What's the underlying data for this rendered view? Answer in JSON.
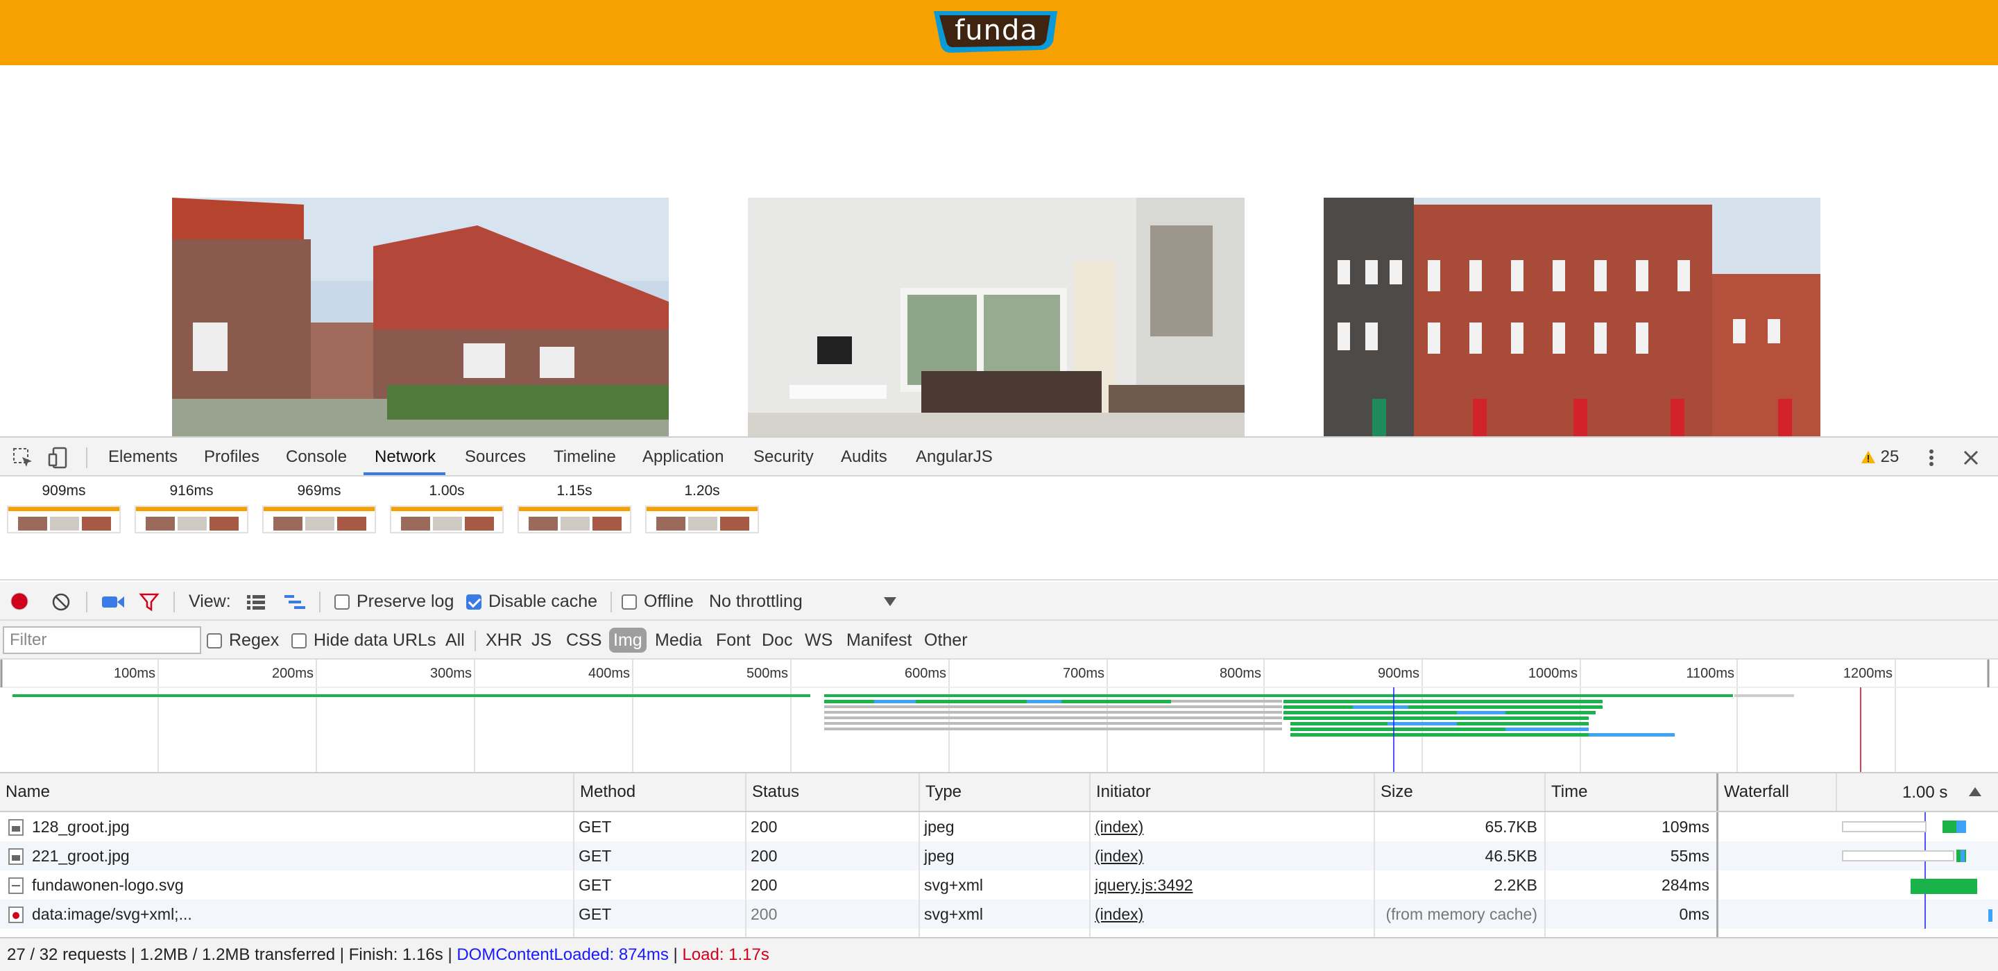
{
  "site": {
    "logo_text": "funda",
    "header_color": "#f7a100"
  },
  "devtools": {
    "tabs": [
      "Elements",
      "Profiles",
      "Console",
      "Network",
      "Sources",
      "Timeline",
      "Application",
      "Security",
      "Audits",
      "AngularJS"
    ],
    "active_tab": "Network",
    "warnings_count": "25",
    "filmstrip": [
      "909ms",
      "916ms",
      "969ms",
      "1.00s",
      "1.15s",
      "1.20s"
    ],
    "toolbar": {
      "view_label": "View:",
      "preserve_log": "Preserve log",
      "preserve_log_checked": false,
      "disable_cache": "Disable cache",
      "disable_cache_checked": true,
      "offline": "Offline",
      "offline_checked": false,
      "throttling": "No throttling"
    },
    "filter": {
      "placeholder": "Filter",
      "regex": "Regex",
      "hide_data_urls": "Hide data URLs",
      "types": [
        "All",
        "XHR",
        "JS",
        "CSS",
        "Img",
        "Media",
        "Font",
        "Doc",
        "WS",
        "Manifest",
        "Other"
      ],
      "selected_type": "Img"
    },
    "overview_ticks": [
      "100ms",
      "200ms",
      "300ms",
      "400ms",
      "500ms",
      "600ms",
      "700ms",
      "800ms",
      "900ms",
      "1000ms",
      "1100ms",
      "1200ms"
    ],
    "table": {
      "columns": [
        "Name",
        "Method",
        "Status",
        "Type",
        "Initiator",
        "Size",
        "Time",
        "Waterfall"
      ],
      "waterfall_time": "1.00 s",
      "rows": [
        {
          "name": "128_groot.jpg",
          "method": "GET",
          "status": "200",
          "type": "jpeg",
          "initiator": "(index)",
          "size": "65.7KB",
          "time": "109ms"
        },
        {
          "name": "221_groot.jpg",
          "method": "GET",
          "status": "200",
          "type": "jpeg",
          "initiator": "(index)",
          "size": "46.5KB",
          "time": "55ms"
        },
        {
          "name": "fundawonen-logo.svg",
          "method": "GET",
          "status": "200",
          "type": "svg+xml",
          "initiator": "jquery.js:3492",
          "size": "2.2KB",
          "time": "284ms"
        },
        {
          "name": "data:image/svg+xml;...",
          "method": "GET",
          "status": "200",
          "type": "svg+xml",
          "initiator": "(index)",
          "size": "(from memory cache)",
          "time": "0ms"
        }
      ]
    },
    "status": {
      "summary": "27 / 32 requests | 1.2MB / 1.2MB transferred | Finish: 1.16s |",
      "dom_content_loaded": "DOMContentLoaded: 874ms",
      "separator": "|",
      "load": "Load: 1.17s"
    }
  }
}
